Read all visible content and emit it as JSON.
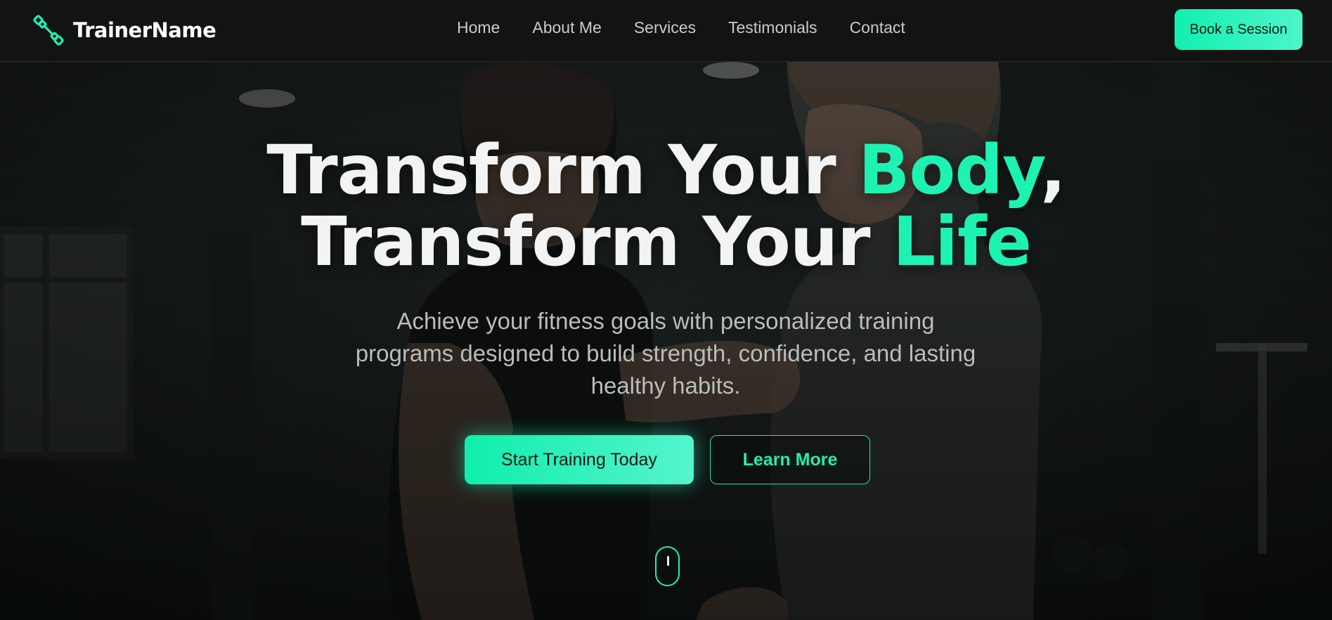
{
  "header": {
    "brand_name": "TrainerName",
    "nav": [
      "Home",
      "About Me",
      "Services",
      "Testimonials",
      "Contact"
    ],
    "cta_label": "Book a Session"
  },
  "hero": {
    "headline_line1_part1": "Transform Your ",
    "headline_line1_accent": "Body",
    "headline_line1_part2": ",",
    "headline_line2_part1": "Transform Your ",
    "headline_line2_accent": "Life",
    "subtitle": "Achieve your fitness goals with personalized training programs designed to build strength, confidence, and lasting healthy habits.",
    "primary_button": "Start Training Today",
    "secondary_button": "Learn More"
  },
  "icons": {
    "logo": "dumbbell-icon",
    "scroll": "mouse-scroll-icon"
  },
  "colors": {
    "accent": "#1df2b2",
    "header_bg": "#121413",
    "hero_bg": "#1d2423"
  }
}
